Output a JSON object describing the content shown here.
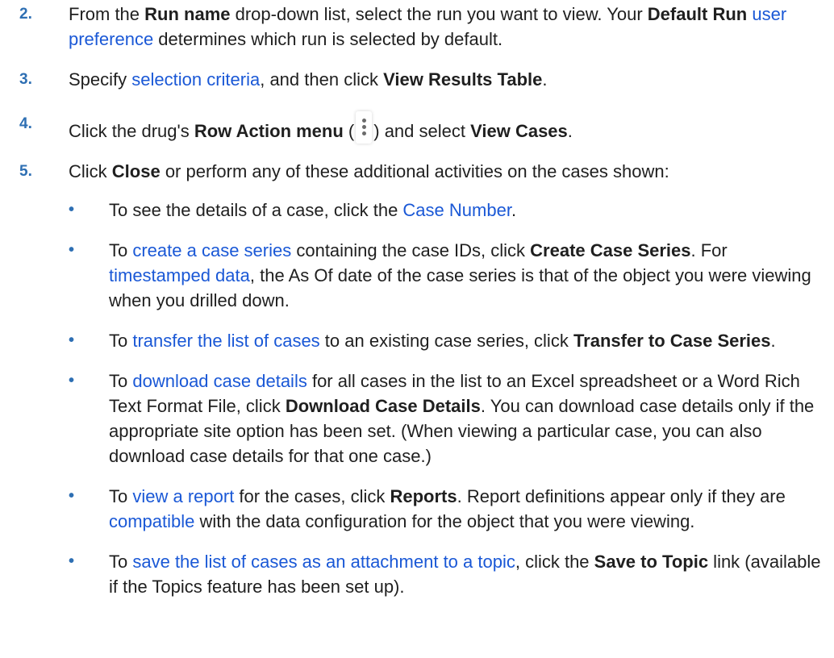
{
  "steps": [
    {
      "number": "2.",
      "t1": "From the ",
      "b1": "Run name",
      "t2": " drop-down list, select the run you want to view. Your ",
      "b2": "Default Run",
      "t3": " ",
      "link1": "user preference",
      "t4": " determines which run is selected by default."
    },
    {
      "number": "3.",
      "t1": "Specify ",
      "link1": "selection criteria",
      "t2": ", and then click ",
      "b1": "View Results Table",
      "t3": "."
    },
    {
      "number": "4.",
      "t1": "Click the drug's ",
      "b1": "Row Action menu",
      "t2": " (",
      "icon": "vertical-ellipsis-icon",
      "t3": ") and select ",
      "b2": "View Cases",
      "t4": "."
    },
    {
      "number": "5.",
      "t1": "Click ",
      "b1": "Close",
      "t2": " or perform any of these additional activities on the cases shown:"
    }
  ],
  "bullets": [
    {
      "symbol": "•",
      "t1": "To see the details of a case, click the ",
      "link1": "Case Number",
      "t2": "."
    },
    {
      "symbol": "•",
      "t1": "To ",
      "link1": "create a case series",
      "t2": " containing the case IDs, click ",
      "b1": "Create Case Series",
      "t3": ". For ",
      "link2": "timestamped data",
      "t4": ", the As Of date of the case series is that of the object you were viewing when you drilled down."
    },
    {
      "symbol": "•",
      "t1": "To ",
      "link1": "transfer the list of cases",
      "t2": " to an existing case series, click ",
      "b1": "Transfer to Case Series",
      "t3": "."
    },
    {
      "symbol": "•",
      "t1": "To ",
      "link1": "download case details",
      "t2": " for all cases in the list to an Excel spreadsheet or a Word Rich Text Format File, click ",
      "b1": "Download Case Details",
      "t3": ". You can download case details only if the appropriate site option has been set. (When viewing a particular case, you can also download case details for that one case.)"
    },
    {
      "symbol": "•",
      "t1": "To ",
      "link1": "view a report",
      "t2": " for the cases, click ",
      "b1": "Reports",
      "t3": ". Report definitions appear only if they are ",
      "link2": "compatible",
      "t4": " with the data configuration for the object that you were viewing."
    },
    {
      "symbol": "•",
      "t1": "To ",
      "link1": "save the list of cases as an attachment to a topic",
      "t2": ", click the ",
      "b1": "Save to Topic",
      "t3": " link (available if the Topics feature has been set up)."
    }
  ],
  "colors": {
    "link": "#1a58d6",
    "list_marker": "#2e6fb3",
    "text": "#1f1f1f"
  }
}
